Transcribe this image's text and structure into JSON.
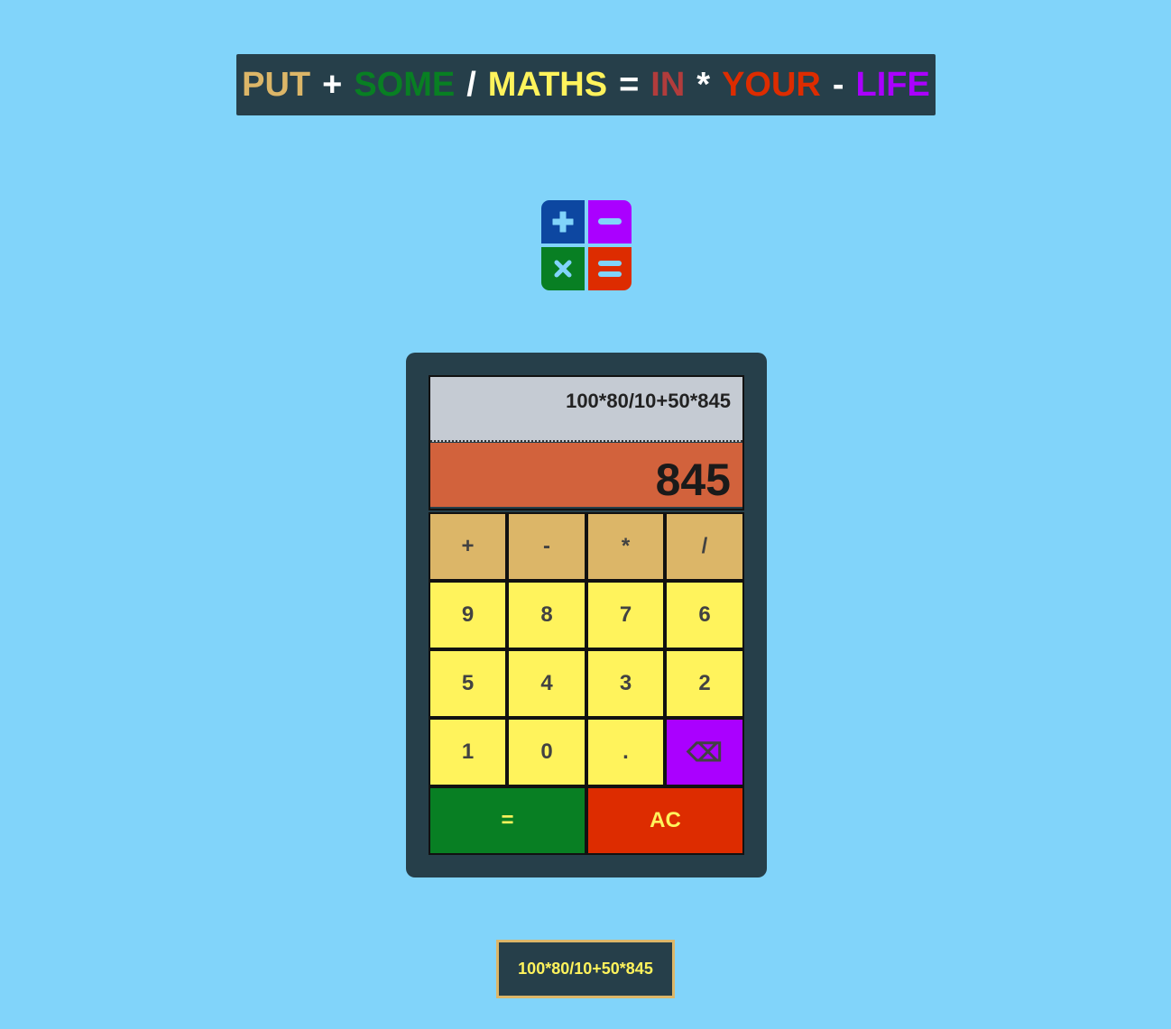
{
  "title": {
    "words": [
      {
        "text": "PUT",
        "color": "#dcb668"
      },
      {
        "text": "SOME",
        "color": "#087f23"
      },
      {
        "text": "MATHS",
        "color": "#fff35c"
      },
      {
        "text": "IN",
        "color": "#b23c3c"
      },
      {
        "text": "YOUR",
        "color": "#dd2c00"
      },
      {
        "text": "LIFE",
        "color": "#aa00ff"
      }
    ],
    "separators": [
      "+",
      "/",
      "=",
      "*",
      "-"
    ]
  },
  "logo": {
    "icons": [
      "plus-icon",
      "minus-icon",
      "times-icon",
      "equals-icon"
    ],
    "colors": [
      "#0d47a1",
      "#aa00ff",
      "#087f23",
      "#dd2c00"
    ]
  },
  "display": {
    "expression": "100*80/10+50*845",
    "result": "845"
  },
  "keys": {
    "add": "+",
    "subtract": "-",
    "multiply": "*",
    "divide": "/",
    "nine": "9",
    "eight": "8",
    "seven": "7",
    "six": "6",
    "five": "5",
    "four": "4",
    "three": "3",
    "two": "2",
    "one": "1",
    "zero": "0",
    "dot": ".",
    "backspace": "⌫",
    "equals": "=",
    "clear": "AC"
  },
  "history": {
    "entry": "100*80/10+50*845"
  },
  "colors": {
    "background": "#81d4fa",
    "panel": "#263f4a",
    "operator_key": "#dcb668",
    "number_key": "#fff35c",
    "result_bg": "#d2623c",
    "expression_bg": "#c5cbd3"
  }
}
